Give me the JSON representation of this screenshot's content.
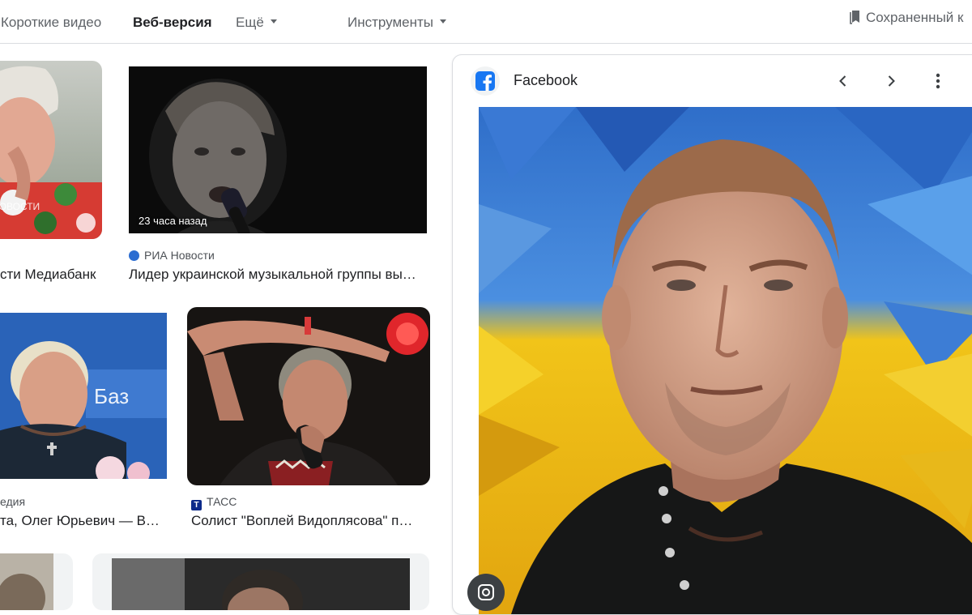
{
  "nav": {
    "short_video": "Короткие видео",
    "web": "Веб-версия",
    "more": "Ещё",
    "tools": "Инструменты",
    "saved": "Сохраненный к"
  },
  "results": [
    {
      "source": "",
      "caption": "сти Медиабанк"
    },
    {
      "time": "23 часа назад",
      "source": "РИА Новости",
      "caption": "Лидер украинской музыкальной группы вы…"
    },
    {
      "source": "едия",
      "caption": "та, Олег Юрьевич — В…"
    },
    {
      "source": "ТАСС",
      "caption": "Солист \"Воплей Видоплясова\" п…"
    }
  ],
  "panel": {
    "source": "Facebook",
    "icons": [
      "facebook-icon",
      "chevron-left-icon",
      "chevron-right-icon",
      "more-vert-icon",
      "lens-icon"
    ]
  },
  "colors": {
    "accent": "#1a73e8",
    "facebook": "#1877f2",
    "ria": "#2c6dd1",
    "tass": "#0d2a8a"
  }
}
